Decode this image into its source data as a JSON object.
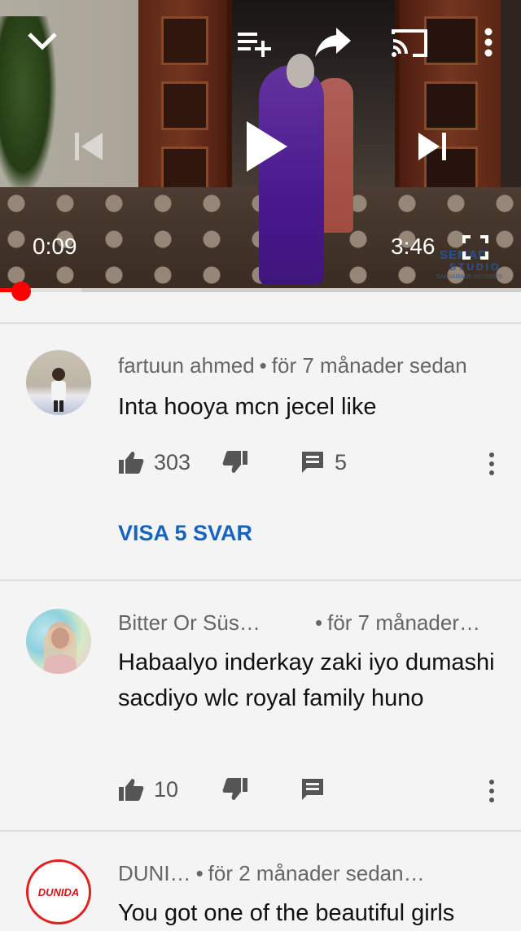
{
  "player": {
    "current_time": "0:09",
    "duration": "3:46",
    "progress_fraction": 0.04,
    "buffer_fraction": 0.156,
    "watermark_line1": "SEMAD",
    "watermark_line2": "STUDIO",
    "watermark_line3": "SARSAMADE RECORDS",
    "accent_color": "#ff0000",
    "icons": {
      "minimize": "chevron-down-icon",
      "add_to_queue": "playlist-add-icon",
      "share": "share-icon",
      "cast": "cast-icon",
      "more": "more-vert-icon",
      "previous": "skip-previous-icon",
      "play": "play-icon",
      "next": "skip-next-icon",
      "fullscreen": "fullscreen-icon"
    }
  },
  "comments": [
    {
      "author": "fartuun ahmed",
      "time": "för 7 månader sedan",
      "text": "Inta hooya mcn jecel like",
      "likes": "303",
      "dislikes": "",
      "reply_count": "5",
      "view_replies": "VISA 5 SVAR"
    },
    {
      "author": "Bitter Or Süs…",
      "time": "för 7 månader…",
      "text": "Habaalyo inderkay zaki iyo dumashi sacdiyo wlc royal family huno",
      "likes": "10",
      "dislikes": "",
      "reply_count": ""
    },
    {
      "author": "DUNI…",
      "time": "för 2 månader sedan…",
      "text": "You got one of the beautiful girls",
      "avatar_text": "DUNIDA"
    }
  ],
  "colors": {
    "link_blue": "#1565c0",
    "background": "#f4f4f4"
  }
}
